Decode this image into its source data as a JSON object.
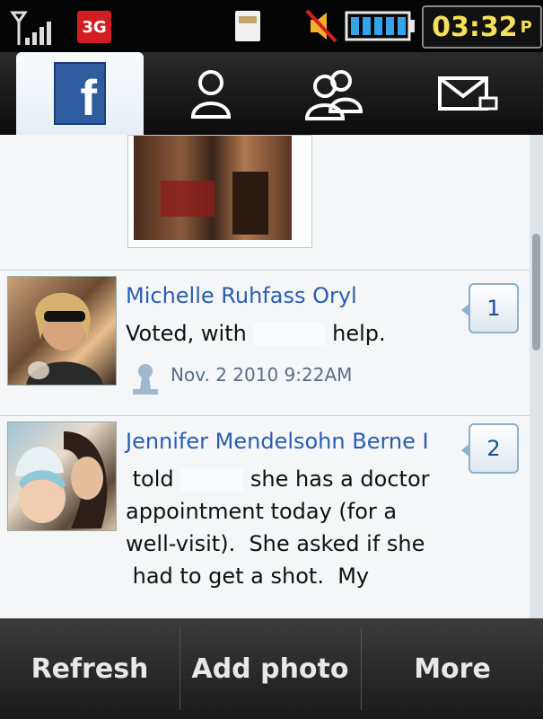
{
  "status_bar": {
    "network": "3G",
    "time": "03:32",
    "time_suffix": "P"
  },
  "tabs": [
    {
      "label": "f",
      "icon": "facebook-icon"
    },
    {
      "label": "",
      "icon": "person-icon"
    },
    {
      "label": "",
      "icon": "people-icon"
    },
    {
      "label": "",
      "icon": "envelope-icon"
    }
  ],
  "feed": [
    {
      "name": "Michelle Ruhfass Oryl",
      "text_before": "Voted, with",
      "text_after": "help.",
      "timestamp": "Nov. 2 2010 9:22AM",
      "comments": "1"
    },
    {
      "name": "Jennifer Mendelsohn Berne I",
      "text_line1_before": " told",
      "text_line1_after": "she has a doctor",
      "text_rest": "appointment today (for a\nwell-visit).  She asked if she\n had to get a shot.  My",
      "comments": "2"
    }
  ],
  "bottom_buttons": {
    "refresh": "Refresh",
    "add_photo": "Add photo",
    "more": "More"
  },
  "colors": {
    "name_link": "#2a5db0",
    "facebook_blue": "#2f5c9e",
    "clock_yellow": "#f4e05a"
  }
}
